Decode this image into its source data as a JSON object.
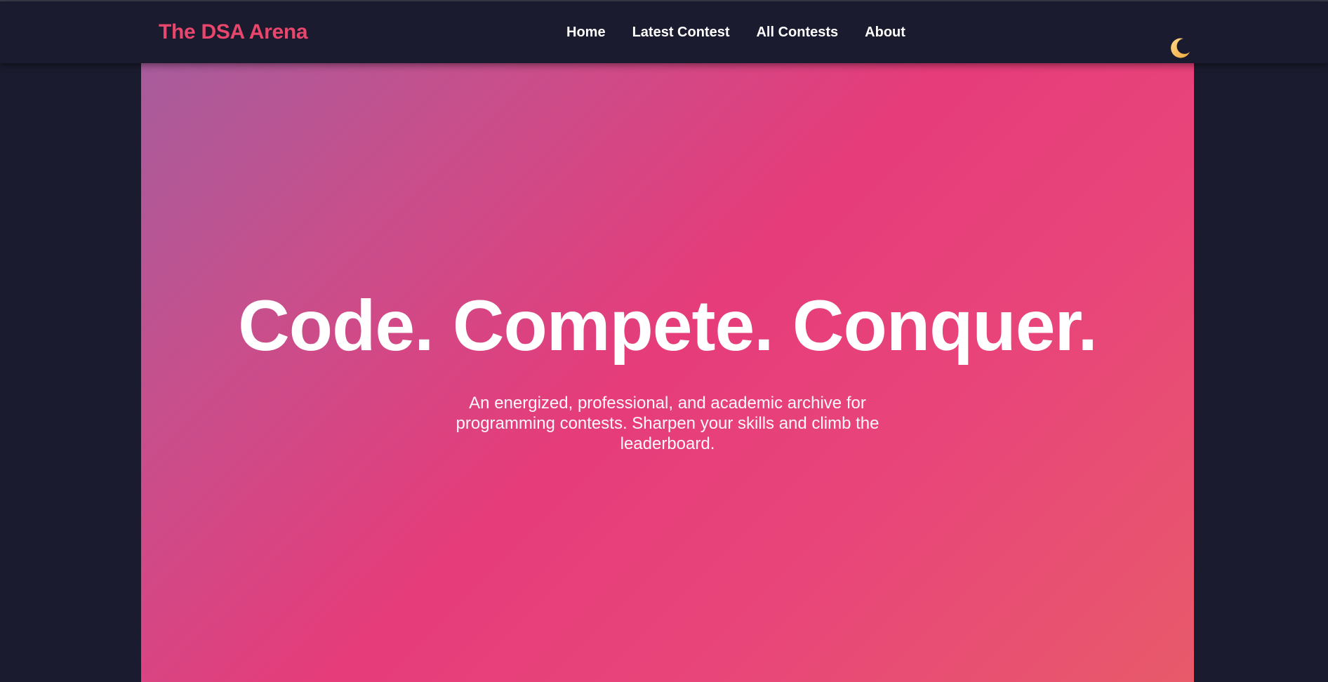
{
  "brand": {
    "name": "The DSA Arena",
    "color": "#e8466c"
  },
  "nav": {
    "items": [
      {
        "label": "Home"
      },
      {
        "label": "Latest Contest"
      },
      {
        "label": "All Contests"
      },
      {
        "label": "About"
      }
    ]
  },
  "theme_toggle": {
    "icon": "moon-icon",
    "color": "#f5c064"
  },
  "hero": {
    "title": "Code. Compete. Conquer.",
    "subtitle": "An energized, professional, and academic archive for programming contests. Sharpen your skills and climb the leaderboard.",
    "gradient": [
      "#a75c9c",
      "#e63c7a",
      "#e85a6a"
    ]
  },
  "colors": {
    "background": "#1a1b2e",
    "text": "#ffffff"
  }
}
